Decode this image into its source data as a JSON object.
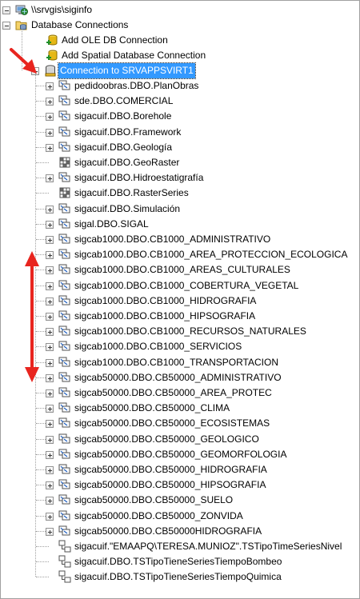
{
  "tree": {
    "server": {
      "label": "\\\\srvgis\\siginfo",
      "icon": "computer-globe-icon"
    },
    "group": {
      "label": "Database Connections",
      "icon": "database-connections-folder-icon"
    },
    "actions": [
      {
        "label": "Add OLE DB Connection",
        "icon": "add-connection-icon"
      },
      {
        "label": "Add Spatial Database Connection",
        "icon": "add-connection-icon"
      }
    ],
    "connection": {
      "label": "Connection to SRVAPPSVIRT1",
      "icon": "database-connection-icon",
      "selected": true
    },
    "items": [
      {
        "label": "pedidoobras.DBO.PlanObras",
        "type": "dataset",
        "expandable": true
      },
      {
        "label": "sde.DBO.COMERCIAL",
        "type": "dataset",
        "expandable": true
      },
      {
        "label": "sigacuif.DBO.Borehole",
        "type": "dataset",
        "expandable": true
      },
      {
        "label": "sigacuif.DBO.Framework",
        "type": "dataset",
        "expandable": true
      },
      {
        "label": "sigacuif.DBO.Geología",
        "type": "dataset",
        "expandable": true
      },
      {
        "label": "sigacuif.DBO.GeoRaster",
        "type": "raster",
        "expandable": false
      },
      {
        "label": "sigacuif.DBO.Hidroestatigrafía",
        "type": "dataset",
        "expandable": true
      },
      {
        "label": "sigacuif.DBO.RasterSeries",
        "type": "raster",
        "expandable": false
      },
      {
        "label": "sigacuif.DBO.Simulación",
        "type": "dataset",
        "expandable": true
      },
      {
        "label": "sigal.DBO.SIGAL",
        "type": "dataset",
        "expandable": true
      },
      {
        "label": "sigcab1000.DBO.CB1000_ADMINISTRATIVO",
        "type": "dataset",
        "expandable": true
      },
      {
        "label": "sigcab1000.DBO.CB1000_AREA_PROTECCION_ECOLOGICA",
        "type": "dataset",
        "expandable": true
      },
      {
        "label": "sigcab1000.DBO.CB1000_AREAS_CULTURALES",
        "type": "dataset",
        "expandable": true
      },
      {
        "label": "sigcab1000.DBO.CB1000_COBERTURA_VEGETAL",
        "type": "dataset",
        "expandable": true
      },
      {
        "label": "sigcab1000.DBO.CB1000_HIDROGRAFIA",
        "type": "dataset",
        "expandable": true
      },
      {
        "label": "sigcab1000.DBO.CB1000_HIPSOGRAFIA",
        "type": "dataset",
        "expandable": true
      },
      {
        "label": "sigcab1000.DBO.CB1000_RECURSOS_NATURALES",
        "type": "dataset",
        "expandable": true
      },
      {
        "label": "sigcab1000.DBO.CB1000_SERVICIOS",
        "type": "dataset",
        "expandable": true
      },
      {
        "label": "sigcab1000.DBO.CB1000_TRANSPORTACION",
        "type": "dataset",
        "expandable": true
      },
      {
        "label": "sigcab50000.DBO.CB50000_ADMINISTRATIVO",
        "type": "dataset",
        "expandable": true
      },
      {
        "label": "sigcab50000.DBO.CB50000_AREA_PROTEC",
        "type": "dataset",
        "expandable": true
      },
      {
        "label": "sigcab50000.DBO.CB50000_CLIMA",
        "type": "dataset",
        "expandable": true
      },
      {
        "label": "sigcab50000.DBO.CB50000_ECOSISTEMAS",
        "type": "dataset",
        "expandable": true
      },
      {
        "label": "sigcab50000.DBO.CB50000_GEOLOGICO",
        "type": "dataset",
        "expandable": true
      },
      {
        "label": "sigcab50000.DBO.CB50000_GEOMORFOLOGIA",
        "type": "dataset",
        "expandable": true
      },
      {
        "label": "sigcab50000.DBO.CB50000_HIDROGRAFIA",
        "type": "dataset",
        "expandable": true
      },
      {
        "label": "sigcab50000.DBO.CB50000_HIPSOGRAFIA",
        "type": "dataset",
        "expandable": true
      },
      {
        "label": "sigcab50000.DBO.CB50000_SUELO",
        "type": "dataset",
        "expandable": true
      },
      {
        "label": "sigcab50000.DBO.CB50000_ZONVIDA",
        "type": "dataset",
        "expandable": true
      },
      {
        "label": "sigcab50000.DBO.CB50000HIDROGRAFIA",
        "type": "dataset",
        "expandable": true
      },
      {
        "label": "sigacuif.\"EMAAPQ\\TERESA.MUNIOZ\".TSTipoTimeSeriesNivel",
        "type": "relationship",
        "expandable": false
      },
      {
        "label": "sigacuif.DBO.TSTipoTieneSeriesTiempoBombeo",
        "type": "relationship",
        "expandable": false
      },
      {
        "label": "sigacuif.DBO.TSTipoTieneSeriesTiempoQuimica",
        "type": "relationship",
        "expandable": false
      }
    ]
  },
  "colors": {
    "selection": "#3399ff",
    "annotation_arrow": "#e8251f",
    "tree_lines": "#a0a0a0"
  }
}
